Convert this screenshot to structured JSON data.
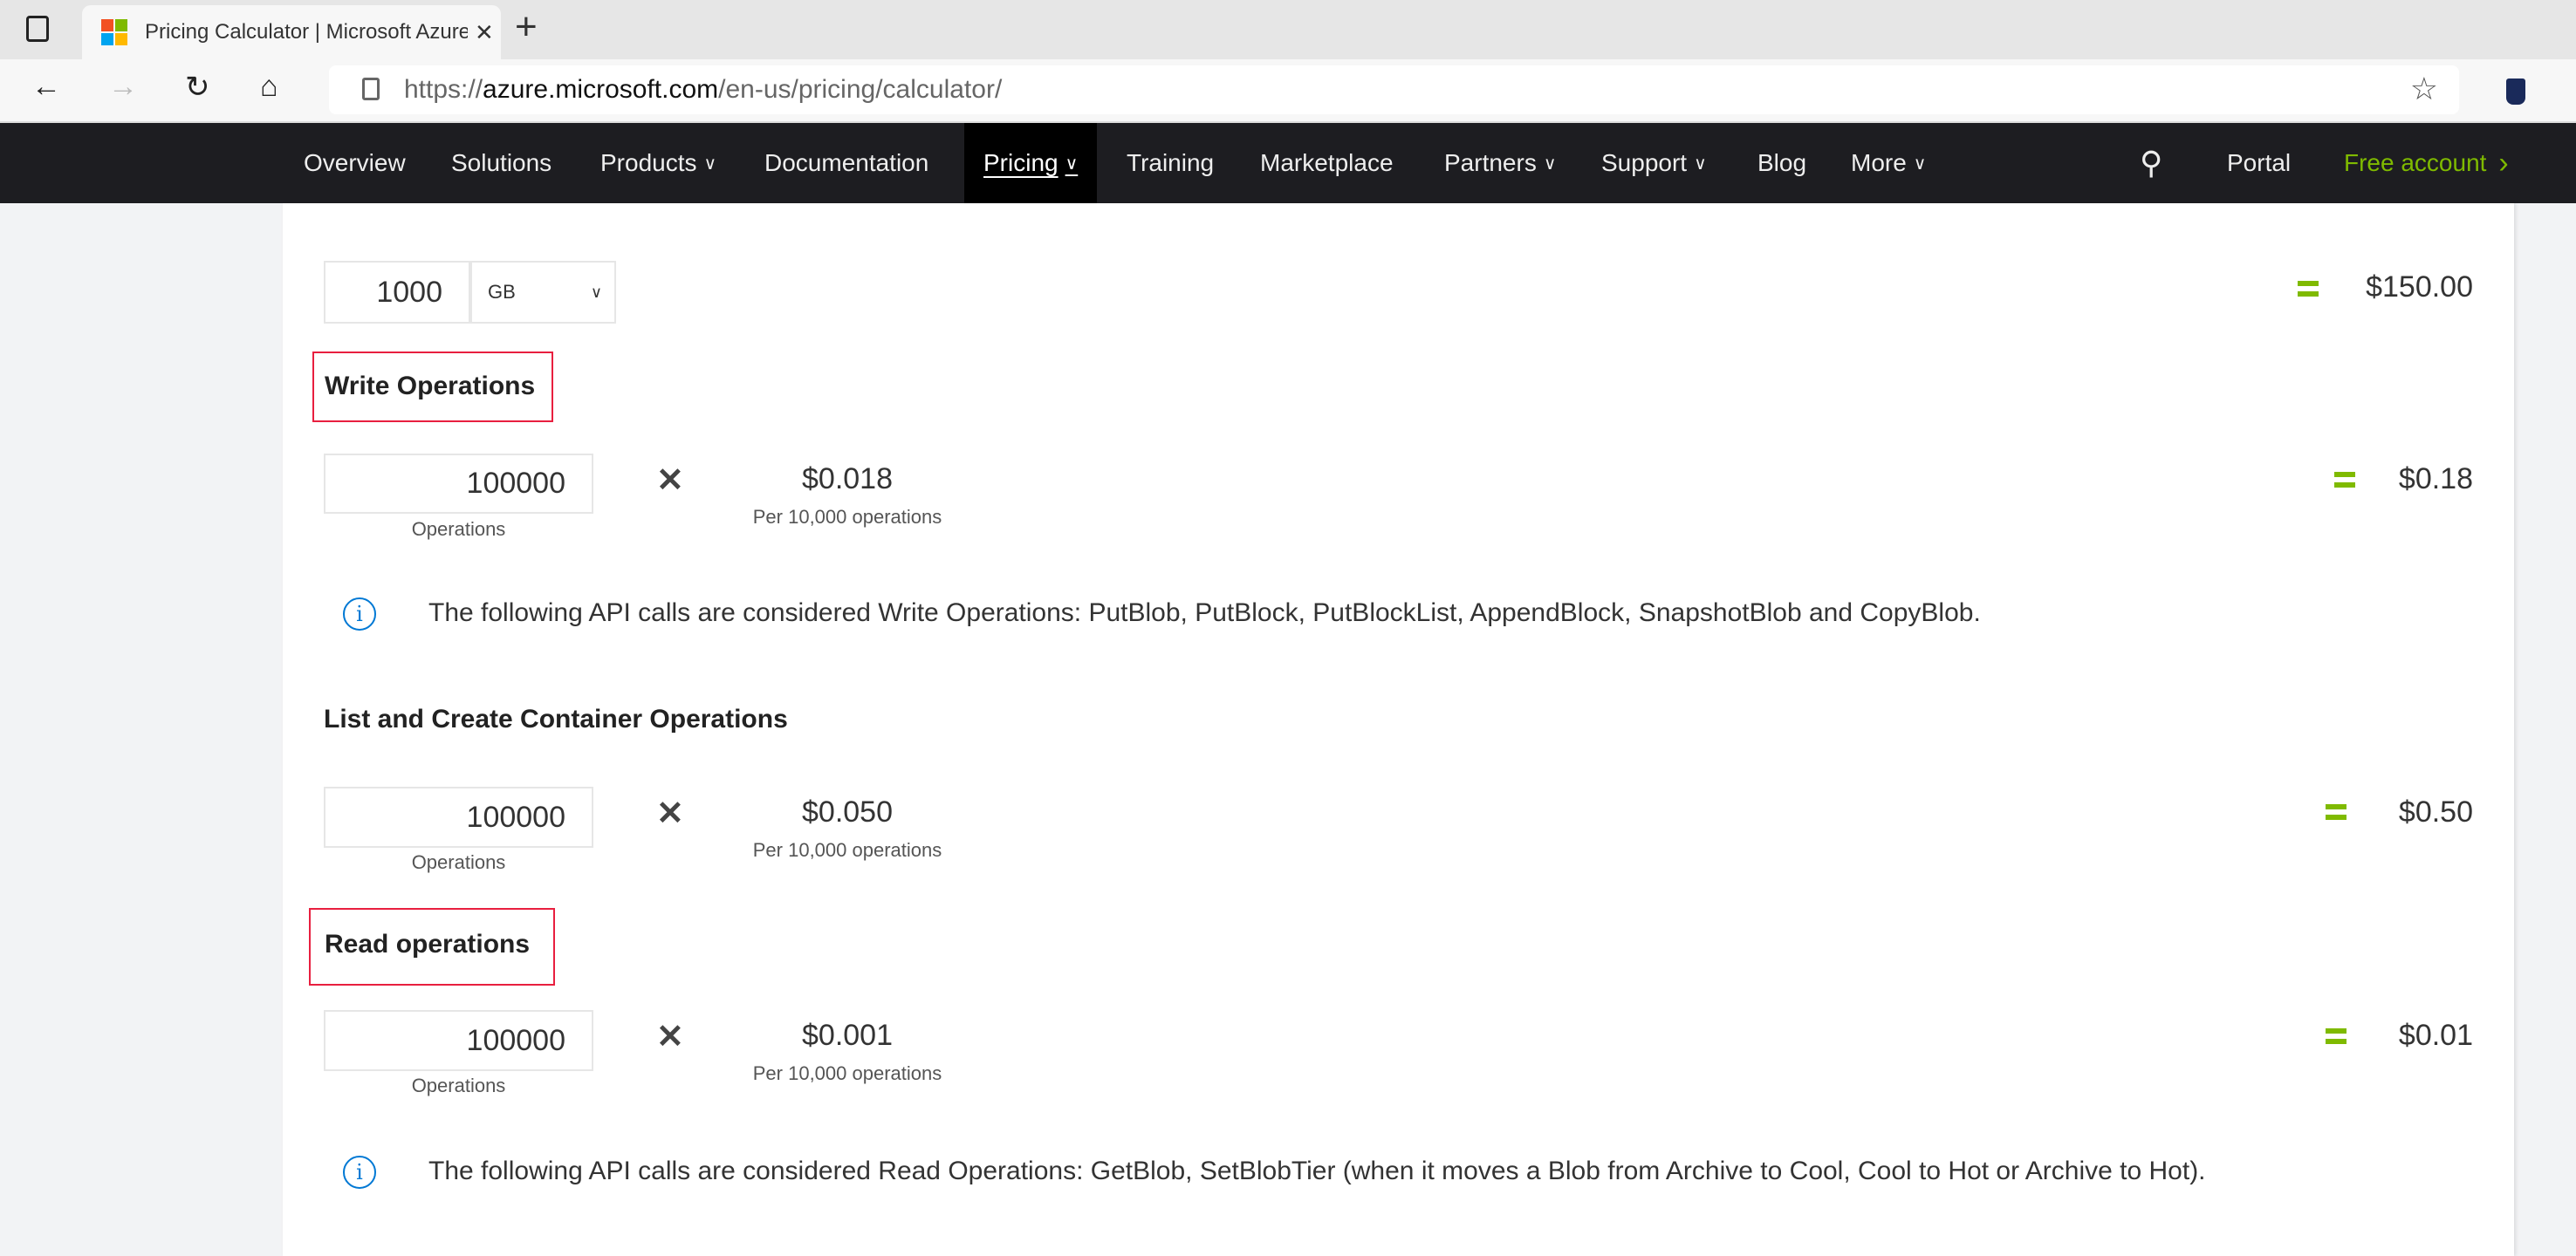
{
  "browser": {
    "tab_title": "Pricing Calculator | Microsoft Azure",
    "url_prefix": "https://",
    "url_host": "azure.microsoft.com",
    "url_path": "/en-us/pricing/calculator/",
    "new_tab": "+",
    "close": "✕"
  },
  "nav": {
    "items": [
      {
        "label": "Overview"
      },
      {
        "label": "Solutions"
      },
      {
        "label": "Products",
        "dropdown": true
      },
      {
        "label": "Documentation"
      },
      {
        "label": "Pricing",
        "dropdown": true,
        "active": true
      },
      {
        "label": "Training"
      },
      {
        "label": "Marketplace"
      },
      {
        "label": "Partners",
        "dropdown": true
      },
      {
        "label": "Support",
        "dropdown": true
      },
      {
        "label": "Blog"
      },
      {
        "label": "More",
        "dropdown": true
      }
    ],
    "portal": "Portal",
    "free_account": "Free account",
    "accent": "#7fba00"
  },
  "capacity": {
    "value": "1000",
    "unit": "GB",
    "total": "$150.00"
  },
  "write": {
    "heading": "Write Operations",
    "value": "100000",
    "unit_label": "Operations",
    "price": "$0.018",
    "per": "Per 10,000 operations",
    "total": "$0.18",
    "note": "The following API calls are considered Write Operations: PutBlob, PutBlock, PutBlockList, AppendBlock, SnapshotBlob and CopyBlob."
  },
  "list": {
    "heading": "List and Create Container Operations",
    "value": "100000",
    "unit_label": "Operations",
    "price": "$0.050",
    "per": "Per 10,000 operations",
    "total": "$0.50"
  },
  "read": {
    "heading": "Read operations",
    "value": "100000",
    "unit_label": "Operations",
    "price": "$0.001",
    "per": "Per 10,000 operations",
    "total": "$0.01",
    "note": "The following API calls are considered Read Operations: GetBlob, SetBlobTier (when it moves a Blob from Archive to Cool, Cool to Hot or Archive to Hot)."
  },
  "symbols": {
    "times": "✕",
    "info": "i"
  }
}
